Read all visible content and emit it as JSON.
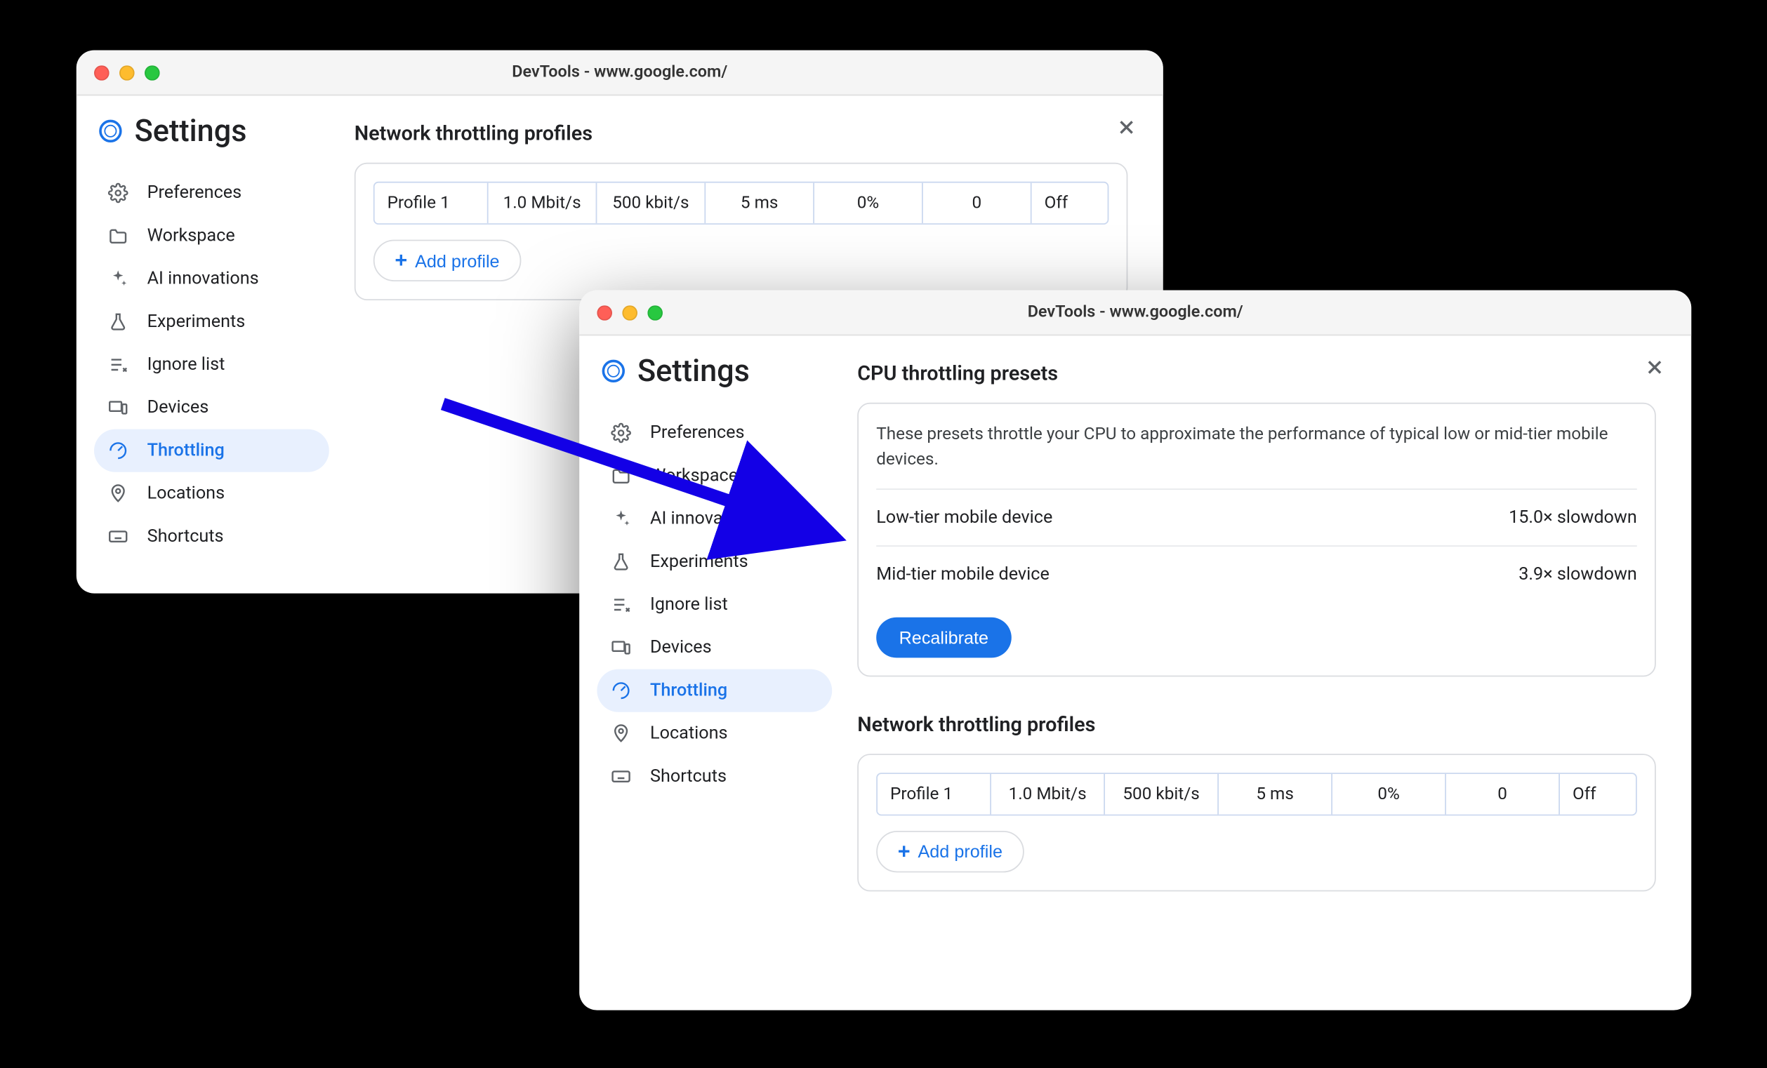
{
  "window1": {
    "title": "DevTools - www.google.com/",
    "settings_title": "Settings",
    "nav": {
      "preferences": "Preferences",
      "workspace": "Workspace",
      "ai": "AI innovations",
      "experiments": "Experiments",
      "ignore": "Ignore list",
      "devices": "Devices",
      "throttling": "Throttling",
      "locations": "Locations",
      "shortcuts": "Shortcuts"
    },
    "section": {
      "network_title": "Network throttling profiles",
      "profile": {
        "name": "Profile 1",
        "down": "1.0 Mbit/s",
        "up": "500 kbit/s",
        "latency": "5 ms",
        "loss": "0%",
        "queue": "0",
        "state": "Off"
      },
      "add_profile": "Add profile"
    }
  },
  "window2": {
    "title": "DevTools - www.google.com/",
    "settings_title": "Settings",
    "nav": {
      "preferences": "Preferences",
      "workspace": "Workspace",
      "ai": "AI innovations",
      "experiments": "Experiments",
      "ignore": "Ignore list",
      "devices": "Devices",
      "throttling": "Throttling",
      "locations": "Locations",
      "shortcuts": "Shortcuts"
    },
    "cpu": {
      "title": "CPU throttling presets",
      "desc": "These presets throttle your CPU to approximate the performance of typical low or mid-tier mobile devices.",
      "low_label": "Low-tier mobile device",
      "low_value": "15.0× slowdown",
      "mid_label": "Mid-tier mobile device",
      "mid_value": "3.9× slowdown",
      "recalibrate": "Recalibrate"
    },
    "network": {
      "title": "Network throttling profiles",
      "profile": {
        "name": "Profile 1",
        "down": "1.0 Mbit/s",
        "up": "500 kbit/s",
        "latency": "5 ms",
        "loss": "0%",
        "queue": "0",
        "state": "Off"
      },
      "add_profile": "Add profile"
    }
  }
}
